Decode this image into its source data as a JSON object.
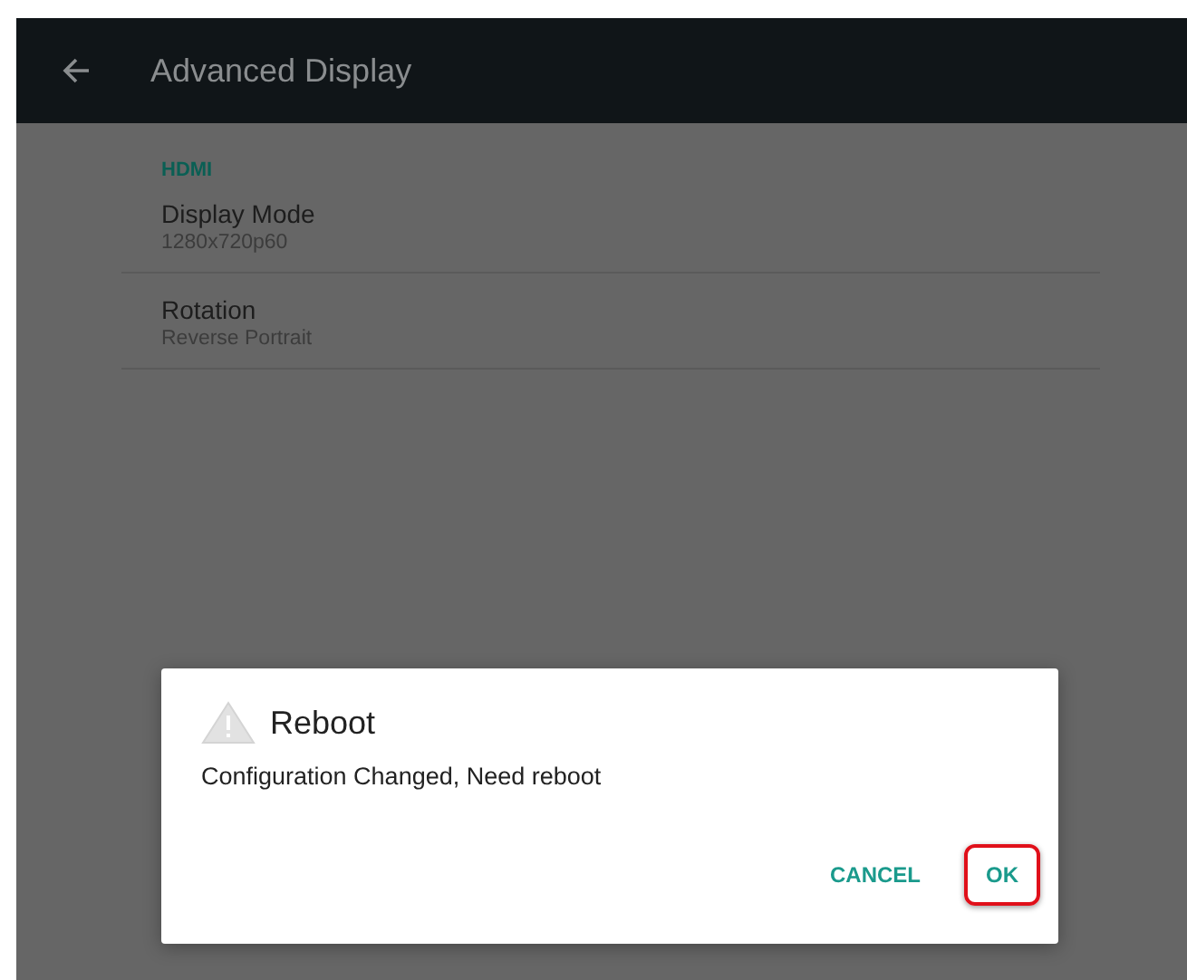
{
  "app_bar": {
    "title": "Advanced Display"
  },
  "section": {
    "header": "HDMI",
    "items": [
      {
        "title": "Display Mode",
        "summary": "1280x720p60"
      },
      {
        "title": "Rotation",
        "summary": "Reverse Portrait"
      }
    ]
  },
  "dialog": {
    "title": "Reboot",
    "message": "Configuration Changed, Need reboot",
    "buttons": [
      {
        "label": "CANCEL",
        "highlighted": false
      },
      {
        "label": "OK",
        "highlighted": true
      }
    ]
  }
}
